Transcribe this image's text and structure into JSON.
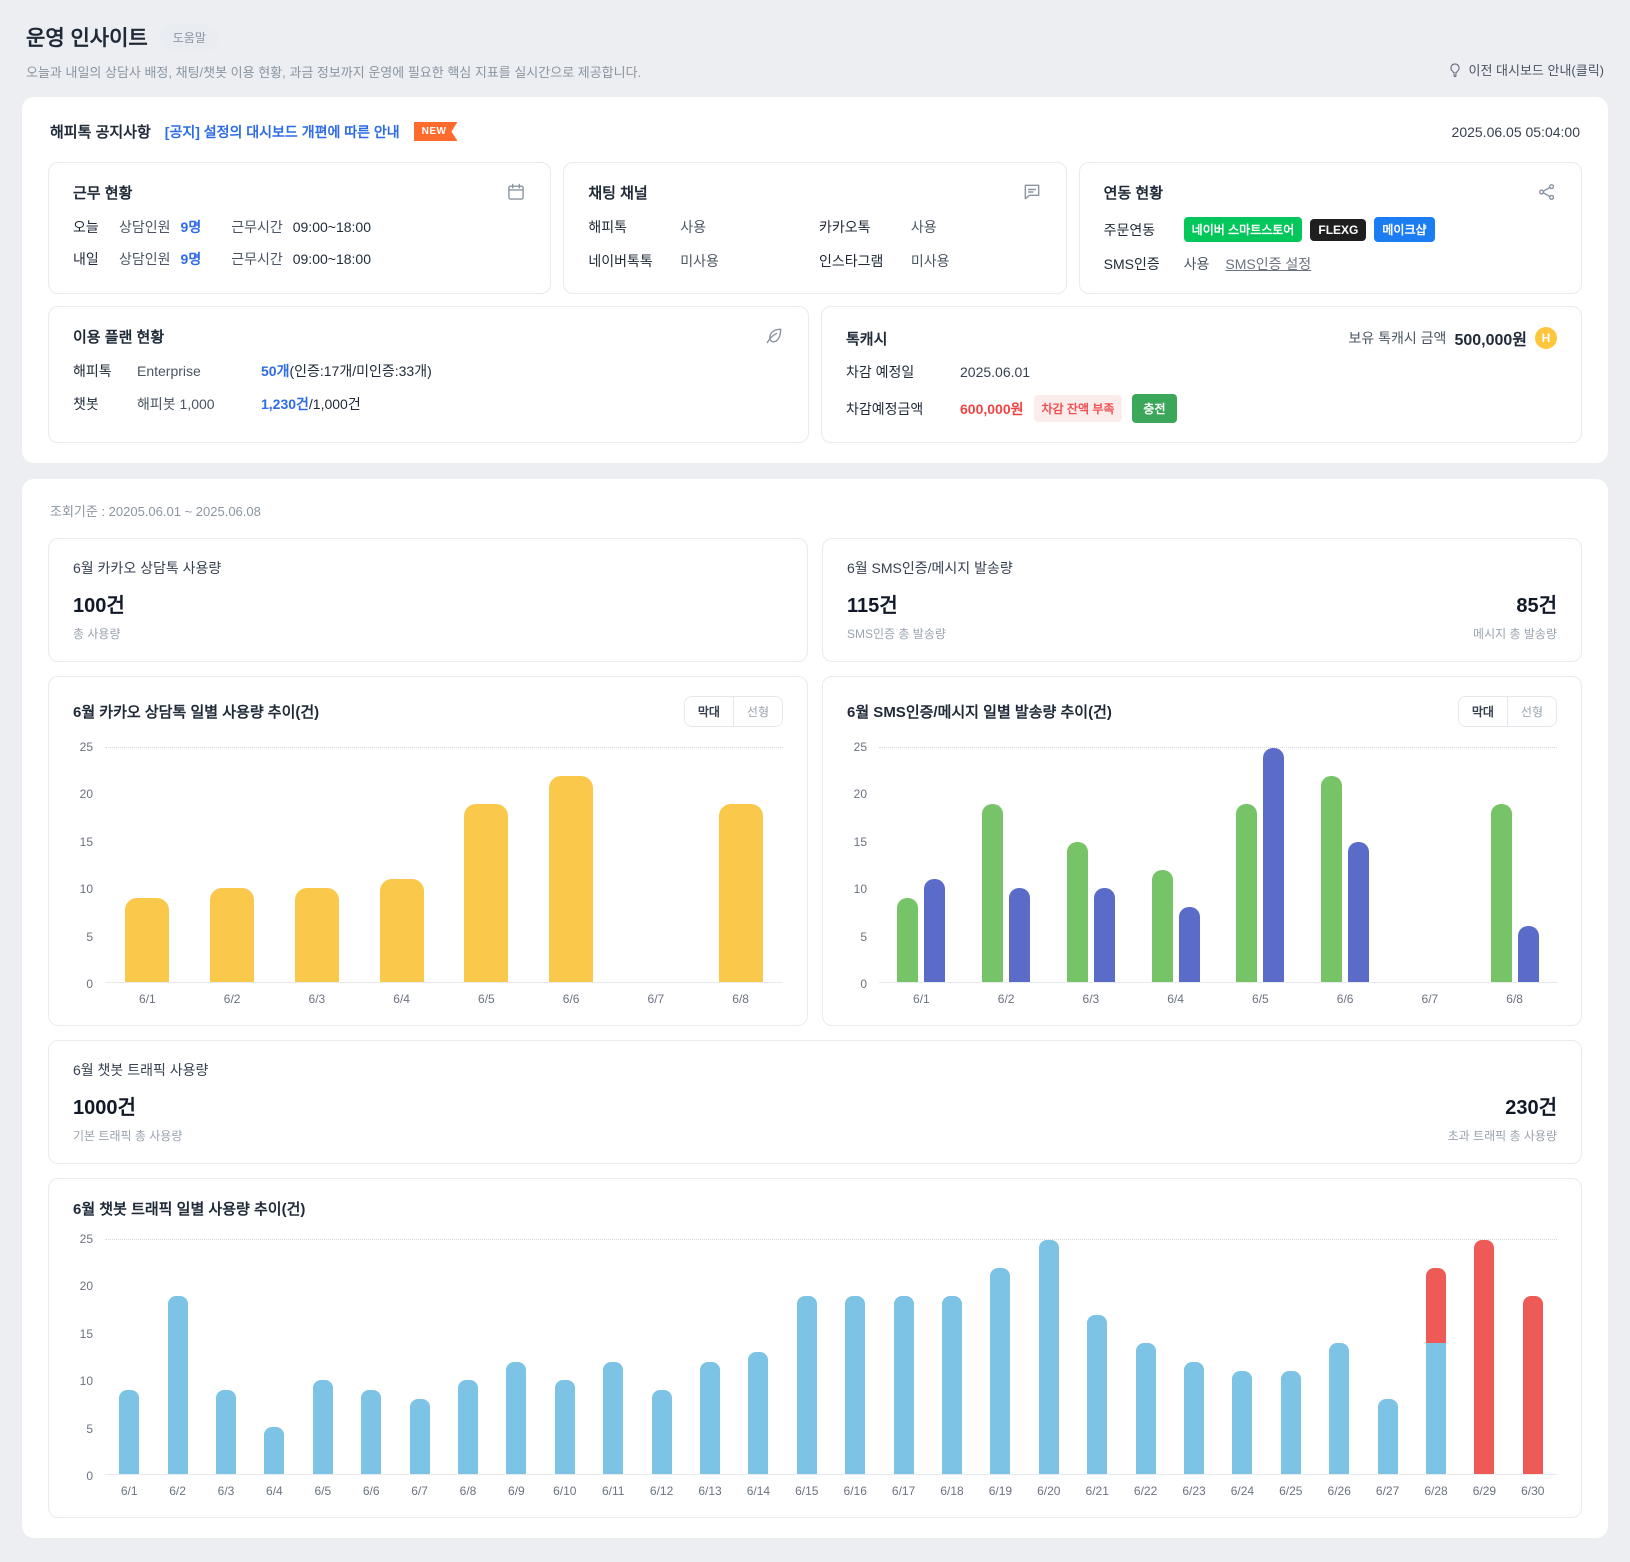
{
  "colors": {
    "accent_blue": "#2E6BE6",
    "alert_red": "#EF4444",
    "bar_yellow": "#FAC84B",
    "bar_green": "#76C368",
    "bar_indigo": "#5A6CC8",
    "bar_sky": "#7CC3E5",
    "bar_red": "#EE5B57",
    "charge_green": "#3BA758",
    "new_badge_orange": "#FF6B2C",
    "coin_yellow": "#FFC53D"
  },
  "page": {
    "title": "운영 인사이트",
    "help_badge": "도움말",
    "subtitle": "오늘과 내일의 상담사 배정, 채팅/챗봇 이용 현황, 과금 정보까지 운영에 필요한 핵심 지표를 실시간으로 제공합니다.",
    "prev_dashboard_link": "이전 대시보드 안내(클릭)"
  },
  "notice": {
    "label": "해피톡 공지사항",
    "link": "[공지] 설정의 대시보드 개편에 따른 안내",
    "new_badge": "NEW",
    "timestamp": "2025.06.05 05:04:00"
  },
  "work_status": {
    "title": "근무 현황",
    "rows": [
      {
        "day": "오늘",
        "label1": "상담인원",
        "value1": "9명",
        "label2": "근무시간",
        "value2": "09:00~18:00"
      },
      {
        "day": "내일",
        "label1": "상담인원",
        "value1": "9명",
        "label2": "근무시간",
        "value2": "09:00~18:00"
      }
    ]
  },
  "chat_channels": {
    "title": "채팅 채널",
    "items": [
      {
        "name": "해피톡",
        "status": "사용"
      },
      {
        "name": "카카오톡",
        "status": "사용"
      },
      {
        "name": "네이버톡톡",
        "status": "미사용"
      },
      {
        "name": "인스타그램",
        "status": "미사용"
      }
    ]
  },
  "integration": {
    "title": "연동 현황",
    "order_label": "주문연동",
    "badges": [
      {
        "label": "네이버 스마트스토어",
        "color": "#03C75A"
      },
      {
        "label": "FLEXG",
        "color": "#1F1F1F"
      },
      {
        "label": "메이크샵",
        "color": "#1C7DF2"
      }
    ],
    "sms_label": "SMS인증",
    "sms_status": "사용",
    "sms_settings_link": "SMS인증 설정"
  },
  "plan": {
    "title": "이용 플랜 현황",
    "rows": [
      {
        "name": "해피톡",
        "plan": "Enterprise",
        "value": "50개",
        "suffix": "(인증:17개/미인증:33개)"
      },
      {
        "name": "챗봇",
        "plan": "해피봇 1,000",
        "value": "1,230건",
        "suffix": "/1,000건"
      }
    ]
  },
  "talkcash": {
    "title": "톡캐시",
    "balance_label": "보유 톡캐시 금액",
    "balance": "500,000원",
    "coin_letter": "H",
    "deduct_date_label": "차감 예정일",
    "deduct_date": "2025.06.01",
    "deduct_amount_label": "차감예정금액",
    "deduct_amount": "600,000원",
    "warning_badge": "차감 잔액 부족",
    "charge_button": "충전"
  },
  "period": "조회기준 : 20205.06.01 ~ 2025.06.08",
  "stats": {
    "kakao": {
      "title": "6월 카카오 상담톡 사용량",
      "value": "100건",
      "label": "총 사용량"
    },
    "sms": {
      "title": "6월 SMS인증/메시지 발송량",
      "left_value": "115건",
      "left_label": "SMS인증 총 발송량",
      "right_value": "85건",
      "right_label": "메시지 총 발송량"
    },
    "chatbot": {
      "title": "6월 챗봇 트래픽 사용량",
      "left_value": "1000건",
      "left_label": "기본 트래픽 총 사용량",
      "right_value": "230건",
      "right_label": "초과 트래픽 총 사용량"
    }
  },
  "chart_data": [
    {
      "id": "kakao-daily",
      "type": "bar",
      "stacked": false,
      "title": "6월 카카오 상담톡 일별 사용량 추이(건)",
      "toggle": [
        "막대",
        "선형"
      ],
      "active_toggle": "막대",
      "categories": [
        "6/1",
        "6/2",
        "6/3",
        "6/4",
        "6/5",
        "6/6",
        "6/7",
        "6/8"
      ],
      "series": [
        {
          "name": "카카오 상담톡",
          "color": "#FAC84B",
          "values": [
            9,
            10,
            10,
            11,
            19,
            22,
            0,
            19
          ]
        }
      ],
      "ylim": [
        0,
        25
      ],
      "yticks": [
        0,
        5,
        10,
        15,
        20,
        25
      ],
      "grid": "dotted-top-only",
      "legend": "none"
    },
    {
      "id": "sms-daily",
      "type": "bar",
      "stacked": false,
      "title": "6월 SMS인증/메시지 일별 발송량 추이(건)",
      "toggle": [
        "막대",
        "선형"
      ],
      "active_toggle": "막대",
      "categories": [
        "6/1",
        "6/2",
        "6/3",
        "6/4",
        "6/5",
        "6/6",
        "6/7",
        "6/8"
      ],
      "series": [
        {
          "name": "SMS인증",
          "color": "#76C368",
          "values": [
            9,
            19,
            15,
            12,
            19,
            22,
            0,
            19
          ]
        },
        {
          "name": "메시지",
          "color": "#5A6CC8",
          "values": [
            11,
            10,
            10,
            8,
            25,
            15,
            0,
            6
          ]
        }
      ],
      "ylim": [
        0,
        25
      ],
      "yticks": [
        0,
        5,
        10,
        15,
        20,
        25
      ],
      "grid": "dotted-top-only",
      "legend": "none"
    },
    {
      "id": "chatbot-daily",
      "type": "bar",
      "stacked": true,
      "title": "6월 챗봇 트래픽 일별 사용량 추이(건)",
      "categories": [
        "6/1",
        "6/2",
        "6/3",
        "6/4",
        "6/5",
        "6/6",
        "6/7",
        "6/8",
        "6/9",
        "6/10",
        "6/11",
        "6/12",
        "6/13",
        "6/14",
        "6/15",
        "6/16",
        "6/17",
        "6/18",
        "6/19",
        "6/20",
        "6/21",
        "6/22",
        "6/23",
        "6/24",
        "6/25",
        "6/26",
        "6/27",
        "6/28",
        "6/29",
        "6/30"
      ],
      "series": [
        {
          "name": "기본 트래픽",
          "color": "#7CC3E5",
          "values": [
            9,
            19,
            9,
            5,
            10,
            9,
            8,
            10,
            12,
            10,
            12,
            9,
            12,
            13,
            19,
            19,
            19,
            19,
            22,
            25,
            17,
            14,
            12,
            11,
            11,
            14,
            8,
            14,
            0,
            0
          ]
        },
        {
          "name": "초과 트래픽",
          "color": "#EE5B57",
          "values": [
            0,
            0,
            0,
            0,
            0,
            0,
            0,
            0,
            0,
            0,
            0,
            0,
            0,
            0,
            0,
            0,
            0,
            0,
            0,
            0,
            0,
            0,
            0,
            0,
            0,
            0,
            0,
            8,
            25,
            19
          ]
        }
      ],
      "ylim": [
        0,
        25
      ],
      "yticks": [
        0,
        5,
        10,
        15,
        20,
        25
      ],
      "grid": "dotted-top-only",
      "legend": "none"
    }
  ]
}
